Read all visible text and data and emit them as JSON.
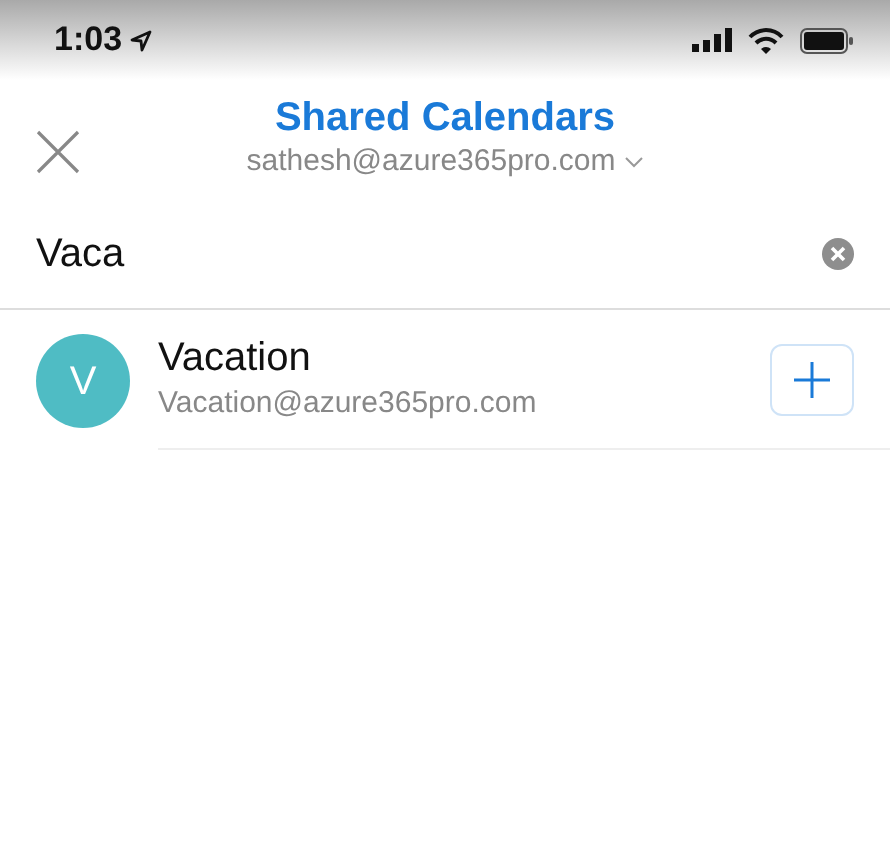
{
  "status_bar": {
    "time": "1:03"
  },
  "header": {
    "title": "Shared Calendars",
    "account": "sathesh@azure365pro.com"
  },
  "search": {
    "value": "Vaca"
  },
  "results": [
    {
      "initial": "V",
      "name": "Vacation",
      "email": "Vacation@azure365pro.com",
      "color": "#4fbcc4"
    }
  ]
}
